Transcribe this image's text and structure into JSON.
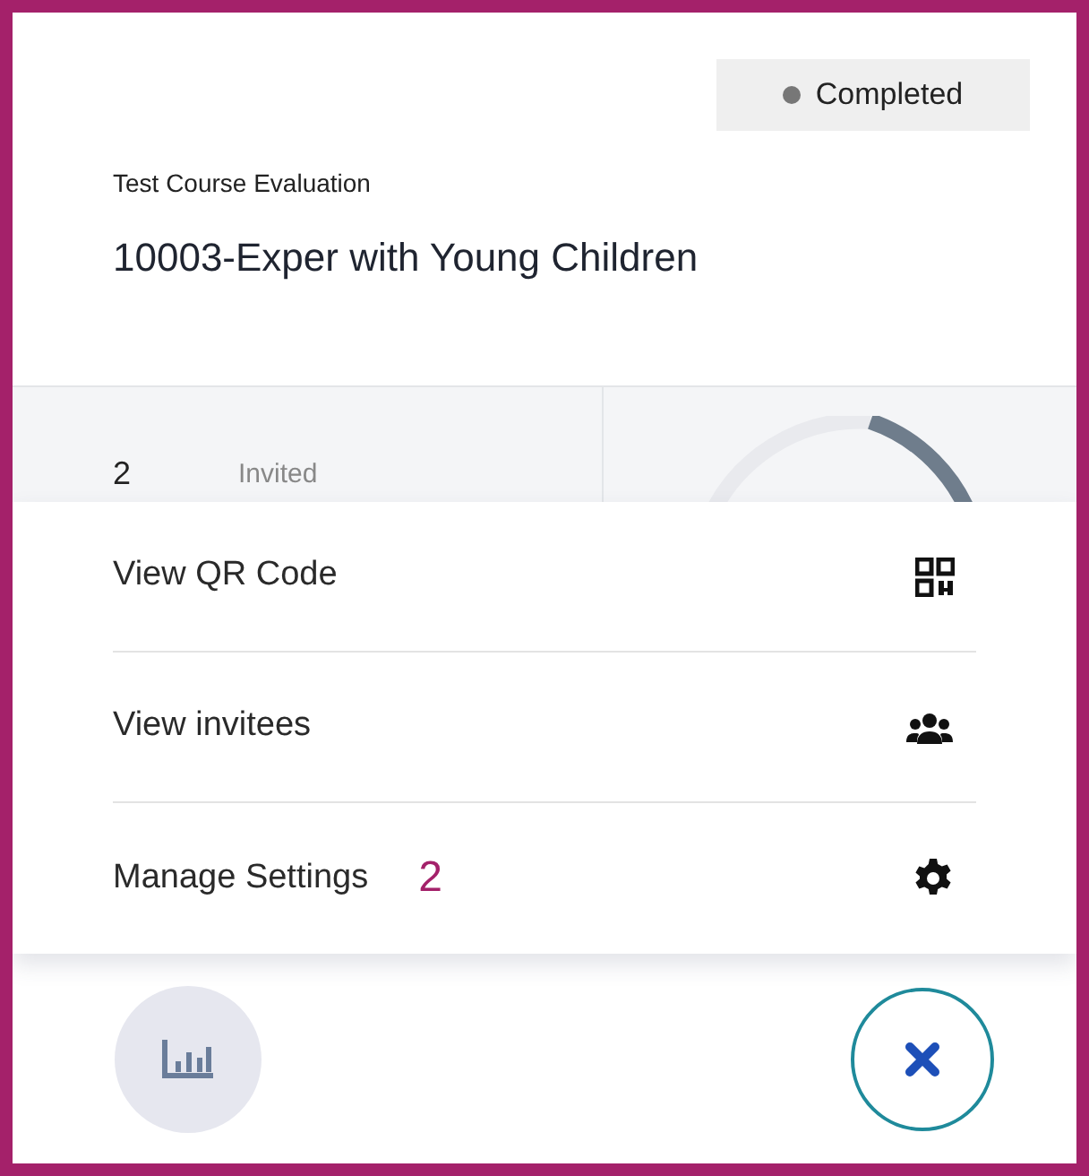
{
  "status": {
    "label": "Completed"
  },
  "header": {
    "subtitle": "Test Course Evaluation",
    "title": "10003-Exper with Young Children"
  },
  "stats": {
    "count": "2",
    "label": "Invited"
  },
  "menu": [
    {
      "label": "View QR Code"
    },
    {
      "label": "View invitees"
    },
    {
      "label": "Manage Settings"
    }
  ],
  "annotation": "2"
}
